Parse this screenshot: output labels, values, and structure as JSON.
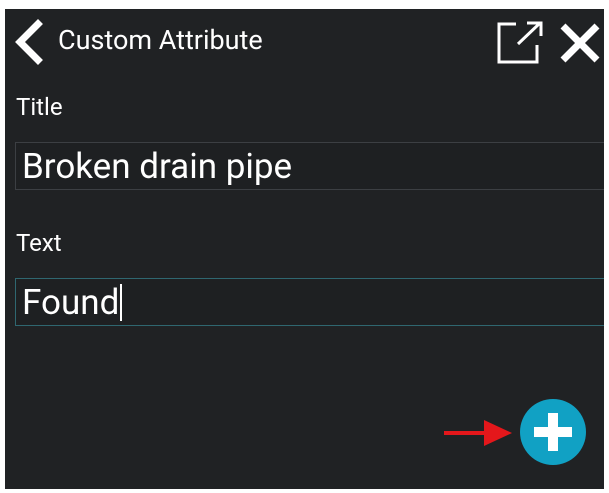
{
  "header": {
    "title": "Custom Attribute",
    "back_icon": "chevron-left-icon",
    "open_icon": "open-in-new-icon",
    "close_icon": "close-icon"
  },
  "form": {
    "title_label": "Title",
    "title_value": "Broken drain pipe",
    "text_label": "Text",
    "text_value": "Found"
  },
  "fab": {
    "icon": "plus-icon"
  },
  "annotation": {
    "icon": "red-arrow-icon"
  },
  "colors": {
    "background": "#202224",
    "accent": "#11a1c4",
    "annotation": "#e4171b",
    "focused_border": "#2f6770"
  }
}
